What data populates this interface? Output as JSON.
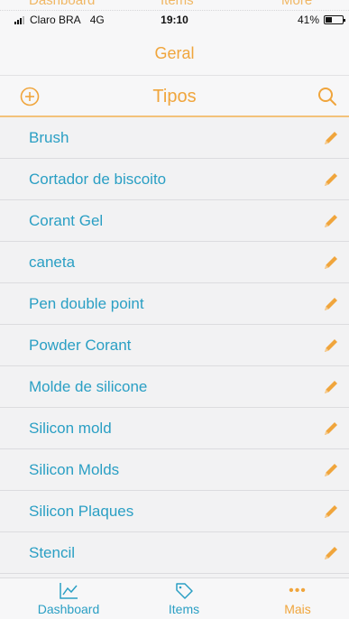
{
  "ghost_tabs": [
    "Dashboard",
    "Items",
    "More"
  ],
  "status_bar": {
    "carrier": "Claro BRA",
    "network": "4G",
    "time": "19:10",
    "battery": "41%",
    "battery_level": 0.41
  },
  "header": {
    "title": "Geral"
  },
  "nav": {
    "title": "Tipos",
    "add_icon": "plus-circle-icon",
    "search_icon": "search-icon"
  },
  "items": [
    {
      "label": "Brush"
    },
    {
      "label": "Cortador de biscoito"
    },
    {
      "label": "Corant Gel"
    },
    {
      "label": "caneta"
    },
    {
      "label": "Pen double point"
    },
    {
      "label": "Powder Corant"
    },
    {
      "label": "Molde de silicone"
    },
    {
      "label": "Silicon mold"
    },
    {
      "label": "Silicon Molds"
    },
    {
      "label": "Silicon Plaques"
    },
    {
      "label": "Stencil"
    }
  ],
  "edit_icon": "pencil-icon",
  "tab_bar": {
    "tabs": [
      {
        "label": "Dashboard",
        "icon": "chart-line-icon",
        "active": false
      },
      {
        "label": "Items",
        "icon": "tag-icon",
        "active": false
      },
      {
        "label": "Mais",
        "icon": "more-dots-icon",
        "active": true
      }
    ]
  },
  "colors": {
    "accent": "#f0a53c",
    "link": "#2a9fc4",
    "background": "#f2f2f3"
  }
}
